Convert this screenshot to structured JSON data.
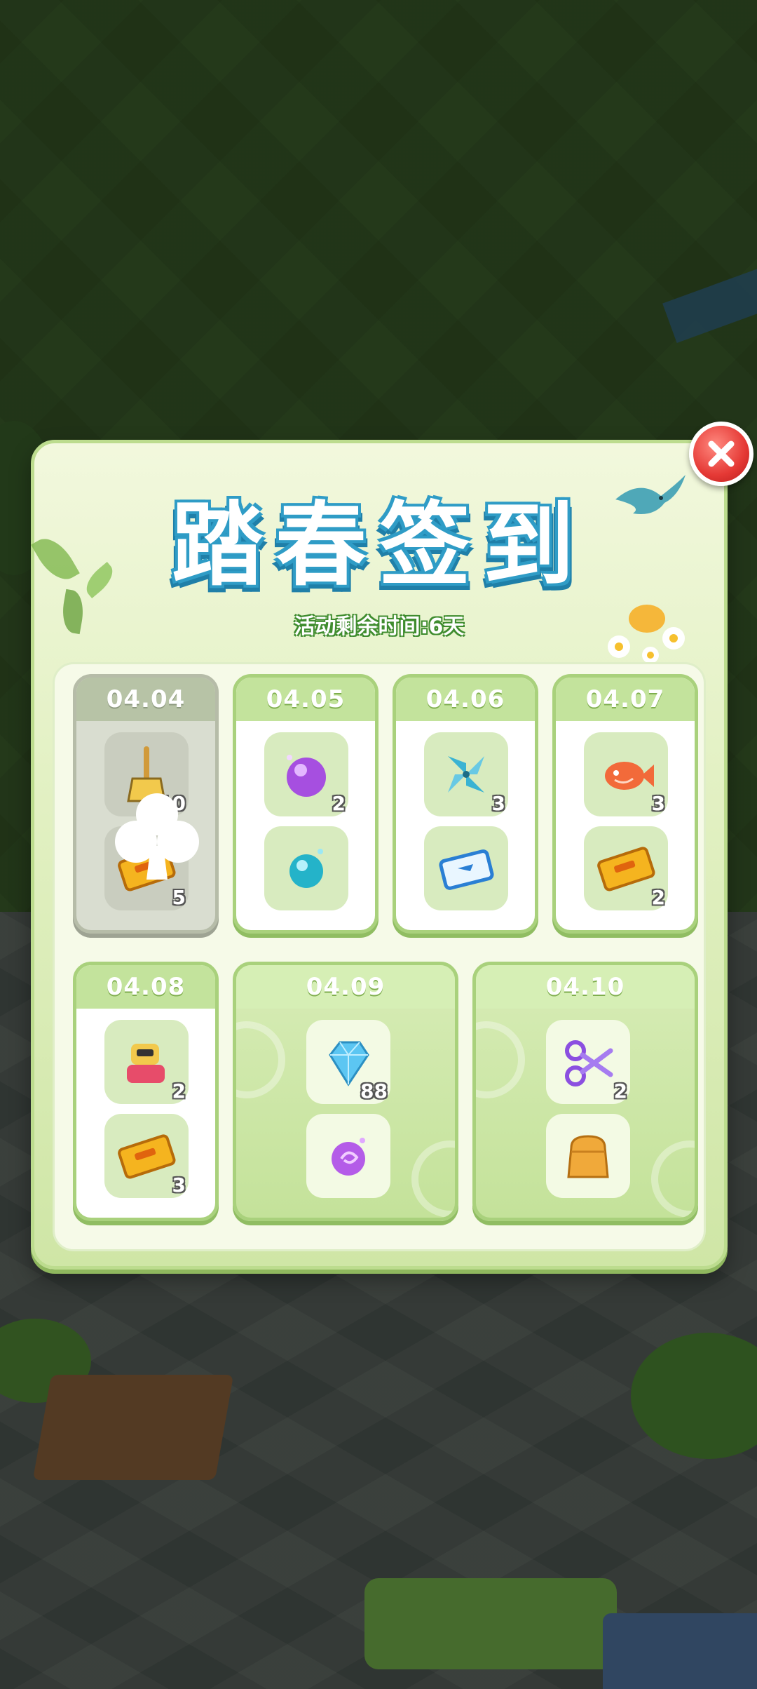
{
  "panel": {
    "title": "踏春签到",
    "subtitle": "活动剩余时间:6天"
  },
  "close_button": {
    "icon": "close-icon"
  },
  "days": [
    {
      "date": "04.04",
      "claimed": true,
      "rewards": [
        {
          "icon": "broom-icon",
          "qty": "10"
        },
        {
          "icon": "gold-ticket-icon",
          "qty": "5"
        }
      ]
    },
    {
      "date": "04.05",
      "claimed": false,
      "rewards": [
        {
          "icon": "purple-orb-icon",
          "qty": "2"
        },
        {
          "icon": "blue-orb-icon",
          "qty": ""
        }
      ]
    },
    {
      "date": "04.06",
      "claimed": false,
      "rewards": [
        {
          "icon": "pinwheel-icon",
          "qty": "3"
        },
        {
          "icon": "blue-ticket-icon",
          "qty": ""
        }
      ]
    },
    {
      "date": "04.07",
      "claimed": false,
      "rewards": [
        {
          "icon": "orange-fish-icon",
          "qty": "3"
        },
        {
          "icon": "gold-ticket-icon",
          "qty": "2"
        }
      ]
    },
    {
      "date": "04.08",
      "claimed": false,
      "rewards": [
        {
          "icon": "robot-toy-icon",
          "qty": "2"
        },
        {
          "icon": "gold-ticket-icon",
          "qty": "3"
        }
      ]
    },
    {
      "date": "04.09",
      "claimed": false,
      "rewards": [
        {
          "icon": "diamond-icon",
          "qty": "88"
        },
        {
          "icon": "purple-swirl-orb-icon",
          "qty": ""
        }
      ]
    },
    {
      "date": "04.10",
      "claimed": false,
      "rewards": [
        {
          "icon": "purple-scissors-icon",
          "qty": "2"
        },
        {
          "icon": "orange-bag-icon",
          "qty": ""
        }
      ]
    }
  ],
  "colors": {
    "panel": "#e3f1c4",
    "card_header": "#c3e39c",
    "title_outline": "#2f9cc6",
    "close": "#e53935"
  }
}
